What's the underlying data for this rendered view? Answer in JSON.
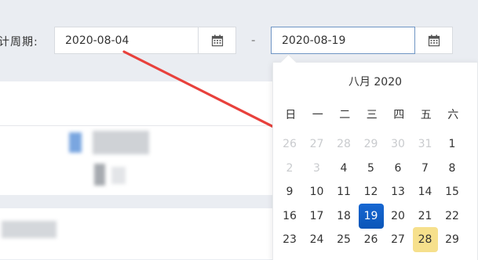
{
  "filter": {
    "period_label": "计周期:",
    "start_date": "2020-08-04",
    "end_date": "2020-08-19",
    "separator": "-"
  },
  "datepicker": {
    "month_title": "八月 2020",
    "weekdays": [
      "日",
      "一",
      "二",
      "三",
      "四",
      "五",
      "六"
    ],
    "weeks": [
      [
        {
          "d": "26",
          "muted": true
        },
        {
          "d": "27",
          "muted": true
        },
        {
          "d": "28",
          "muted": true
        },
        {
          "d": "29",
          "muted": true
        },
        {
          "d": "30",
          "muted": true
        },
        {
          "d": "31",
          "muted": true
        },
        {
          "d": "1",
          "muted": false
        }
      ],
      [
        {
          "d": "2",
          "muted": true
        },
        {
          "d": "3",
          "muted": true
        },
        {
          "d": "4",
          "muted": false
        },
        {
          "d": "5",
          "muted": false
        },
        {
          "d": "6",
          "muted": false
        },
        {
          "d": "7",
          "muted": false
        },
        {
          "d": "8",
          "muted": false
        }
      ],
      [
        {
          "d": "9"
        },
        {
          "d": "10"
        },
        {
          "d": "11"
        },
        {
          "d": "12"
        },
        {
          "d": "13"
        },
        {
          "d": "14"
        },
        {
          "d": "15"
        }
      ],
      [
        {
          "d": "16"
        },
        {
          "d": "17"
        },
        {
          "d": "18"
        },
        {
          "d": "19",
          "selected": true
        },
        {
          "d": "20"
        },
        {
          "d": "21"
        },
        {
          "d": "22"
        }
      ],
      [
        {
          "d": "23"
        },
        {
          "d": "24"
        },
        {
          "d": "25"
        },
        {
          "d": "26"
        },
        {
          "d": "27"
        },
        {
          "d": "28",
          "today": true
        },
        {
          "d": "29"
        }
      ]
    ]
  },
  "colors": {
    "accent": "#0b5fc4",
    "highlight": "#f6e08c",
    "arrow": "#e8413c"
  },
  "icons": {
    "calendar": "calendar-icon",
    "annotation": "red-arrow"
  }
}
